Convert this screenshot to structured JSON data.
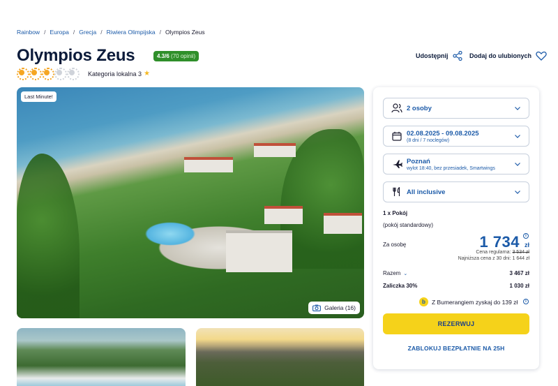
{
  "breadcrumb": [
    "Rainbow",
    "Europa",
    "Grecja",
    "Riwiera Olimpijska",
    "Olympios Zeus"
  ],
  "hotel": {
    "name": "Olympios Zeus",
    "rating": "4.3/6",
    "rating_count": "(70 opinii)",
    "suns_total": 5,
    "suns_filled": 3,
    "local_category": "Kategoria lokalna 3"
  },
  "actions": {
    "share_label": "Udostępnij",
    "favorite_label": "Dodaj do ulubionych"
  },
  "gallery": {
    "badge": "Last Minute!",
    "button_label": "Galeria (16)"
  },
  "booking": {
    "guests": "2 osoby",
    "dates": "02.08.2025 - 09.08.2025",
    "dates_sub": "(8 dni / 7 noclegów)",
    "departure": "Poznań",
    "departure_sub": "wylot 18:40, bez przesiadek, Smartwings",
    "board": "All inclusive",
    "room_count": "1 x Pokój",
    "room_type": "(pokój standardowy)",
    "per_person_label": "Za osobę",
    "price": "1 734",
    "currency": "zł",
    "regular_label": "Cena regularna:",
    "regular_price": "3 534 zł",
    "lowest_label": "Najniższa cena z 30 dni: 1 644 zł",
    "total_label": "Razem",
    "total_value": "3 467 zł",
    "deposit_label": "Zaliczka 30%",
    "deposit_value": "1 030 zł",
    "bumerang_text": "Z Bumerangiem zyskaj do 139 zł",
    "reserve_label": "REZERWUJ",
    "block_label": "ZABLOKUJ BEZPŁATNIE NA 25H"
  },
  "colors": {
    "primary": "#1b5aa8",
    "accent_yellow": "#f5d21a",
    "rating_green": "#2f8f2a",
    "sun": "#f5a623"
  }
}
